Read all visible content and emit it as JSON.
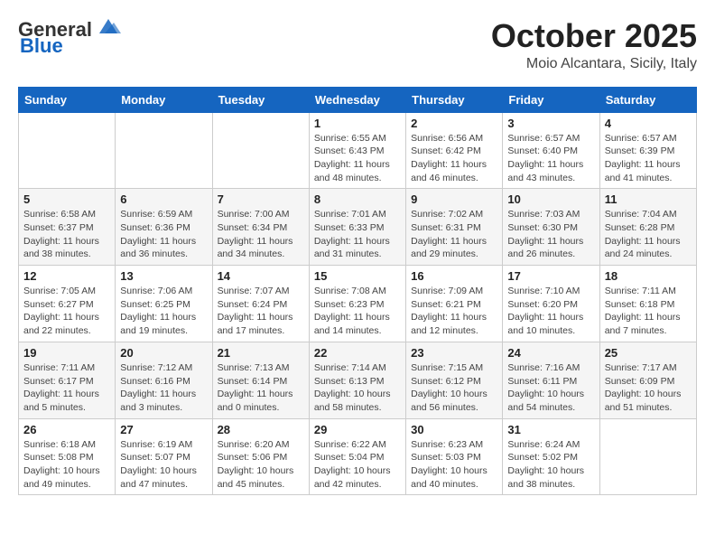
{
  "header": {
    "logo_line1": "General",
    "logo_line2": "Blue",
    "month": "October 2025",
    "location": "Moio Alcantara, Sicily, Italy"
  },
  "weekdays": [
    "Sunday",
    "Monday",
    "Tuesday",
    "Wednesday",
    "Thursday",
    "Friday",
    "Saturday"
  ],
  "weeks": [
    [
      {
        "day": "",
        "info": ""
      },
      {
        "day": "",
        "info": ""
      },
      {
        "day": "",
        "info": ""
      },
      {
        "day": "1",
        "info": "Sunrise: 6:55 AM\nSunset: 6:43 PM\nDaylight: 11 hours\nand 48 minutes."
      },
      {
        "day": "2",
        "info": "Sunrise: 6:56 AM\nSunset: 6:42 PM\nDaylight: 11 hours\nand 46 minutes."
      },
      {
        "day": "3",
        "info": "Sunrise: 6:57 AM\nSunset: 6:40 PM\nDaylight: 11 hours\nand 43 minutes."
      },
      {
        "day": "4",
        "info": "Sunrise: 6:57 AM\nSunset: 6:39 PM\nDaylight: 11 hours\nand 41 minutes."
      }
    ],
    [
      {
        "day": "5",
        "info": "Sunrise: 6:58 AM\nSunset: 6:37 PM\nDaylight: 11 hours\nand 38 minutes."
      },
      {
        "day": "6",
        "info": "Sunrise: 6:59 AM\nSunset: 6:36 PM\nDaylight: 11 hours\nand 36 minutes."
      },
      {
        "day": "7",
        "info": "Sunrise: 7:00 AM\nSunset: 6:34 PM\nDaylight: 11 hours\nand 34 minutes."
      },
      {
        "day": "8",
        "info": "Sunrise: 7:01 AM\nSunset: 6:33 PM\nDaylight: 11 hours\nand 31 minutes."
      },
      {
        "day": "9",
        "info": "Sunrise: 7:02 AM\nSunset: 6:31 PM\nDaylight: 11 hours\nand 29 minutes."
      },
      {
        "day": "10",
        "info": "Sunrise: 7:03 AM\nSunset: 6:30 PM\nDaylight: 11 hours\nand 26 minutes."
      },
      {
        "day": "11",
        "info": "Sunrise: 7:04 AM\nSunset: 6:28 PM\nDaylight: 11 hours\nand 24 minutes."
      }
    ],
    [
      {
        "day": "12",
        "info": "Sunrise: 7:05 AM\nSunset: 6:27 PM\nDaylight: 11 hours\nand 22 minutes."
      },
      {
        "day": "13",
        "info": "Sunrise: 7:06 AM\nSunset: 6:25 PM\nDaylight: 11 hours\nand 19 minutes."
      },
      {
        "day": "14",
        "info": "Sunrise: 7:07 AM\nSunset: 6:24 PM\nDaylight: 11 hours\nand 17 minutes."
      },
      {
        "day": "15",
        "info": "Sunrise: 7:08 AM\nSunset: 6:23 PM\nDaylight: 11 hours\nand 14 minutes."
      },
      {
        "day": "16",
        "info": "Sunrise: 7:09 AM\nSunset: 6:21 PM\nDaylight: 11 hours\nand 12 minutes."
      },
      {
        "day": "17",
        "info": "Sunrise: 7:10 AM\nSunset: 6:20 PM\nDaylight: 11 hours\nand 10 minutes."
      },
      {
        "day": "18",
        "info": "Sunrise: 7:11 AM\nSunset: 6:18 PM\nDaylight: 11 hours\nand 7 minutes."
      }
    ],
    [
      {
        "day": "19",
        "info": "Sunrise: 7:11 AM\nSunset: 6:17 PM\nDaylight: 11 hours\nand 5 minutes."
      },
      {
        "day": "20",
        "info": "Sunrise: 7:12 AM\nSunset: 6:16 PM\nDaylight: 11 hours\nand 3 minutes."
      },
      {
        "day": "21",
        "info": "Sunrise: 7:13 AM\nSunset: 6:14 PM\nDaylight: 11 hours\nand 0 minutes."
      },
      {
        "day": "22",
        "info": "Sunrise: 7:14 AM\nSunset: 6:13 PM\nDaylight: 10 hours\nand 58 minutes."
      },
      {
        "day": "23",
        "info": "Sunrise: 7:15 AM\nSunset: 6:12 PM\nDaylight: 10 hours\nand 56 minutes."
      },
      {
        "day": "24",
        "info": "Sunrise: 7:16 AM\nSunset: 6:11 PM\nDaylight: 10 hours\nand 54 minutes."
      },
      {
        "day": "25",
        "info": "Sunrise: 7:17 AM\nSunset: 6:09 PM\nDaylight: 10 hours\nand 51 minutes."
      }
    ],
    [
      {
        "day": "26",
        "info": "Sunrise: 6:18 AM\nSunset: 5:08 PM\nDaylight: 10 hours\nand 49 minutes."
      },
      {
        "day": "27",
        "info": "Sunrise: 6:19 AM\nSunset: 5:07 PM\nDaylight: 10 hours\nand 47 minutes."
      },
      {
        "day": "28",
        "info": "Sunrise: 6:20 AM\nSunset: 5:06 PM\nDaylight: 10 hours\nand 45 minutes."
      },
      {
        "day": "29",
        "info": "Sunrise: 6:22 AM\nSunset: 5:04 PM\nDaylight: 10 hours\nand 42 minutes."
      },
      {
        "day": "30",
        "info": "Sunrise: 6:23 AM\nSunset: 5:03 PM\nDaylight: 10 hours\nand 40 minutes."
      },
      {
        "day": "31",
        "info": "Sunrise: 6:24 AM\nSunset: 5:02 PM\nDaylight: 10 hours\nand 38 minutes."
      },
      {
        "day": "",
        "info": ""
      }
    ]
  ]
}
